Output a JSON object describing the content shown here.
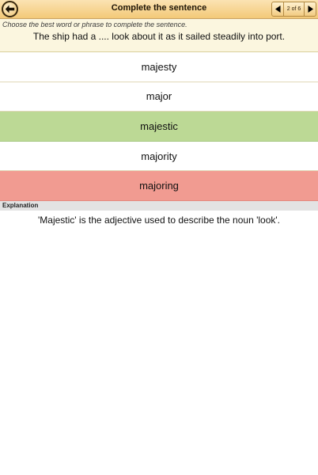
{
  "header": {
    "title": "Complete the sentence",
    "back_icon": "back-arrow-icon",
    "pager": {
      "label": "2 of 6",
      "current": 2,
      "total": 6,
      "prev_icon": "triangle-left-icon",
      "next_icon": "triangle-right-icon"
    }
  },
  "question": {
    "instruction": "Choose the best word or phrase to complete the sentence.",
    "prompt": "The ship had a .... look about it as it sailed steadily into port."
  },
  "options": [
    {
      "label": "majesty",
      "state": "neutral"
    },
    {
      "label": "major",
      "state": "neutral"
    },
    {
      "label": "majestic",
      "state": "correct"
    },
    {
      "label": "majority",
      "state": "neutral"
    },
    {
      "label": "majoring",
      "state": "wrong"
    }
  ],
  "explanation": {
    "heading": "Explanation",
    "text": "'Majestic' is the adjective used to describe the noun 'look'."
  },
  "colors": {
    "header_top": "#fbe3b3",
    "header_bottom": "#f3c978",
    "question_bg": "#fbf6df",
    "correct": "#bcd995",
    "wrong": "#f19b91",
    "explanation_bar": "#e3e3e3"
  }
}
